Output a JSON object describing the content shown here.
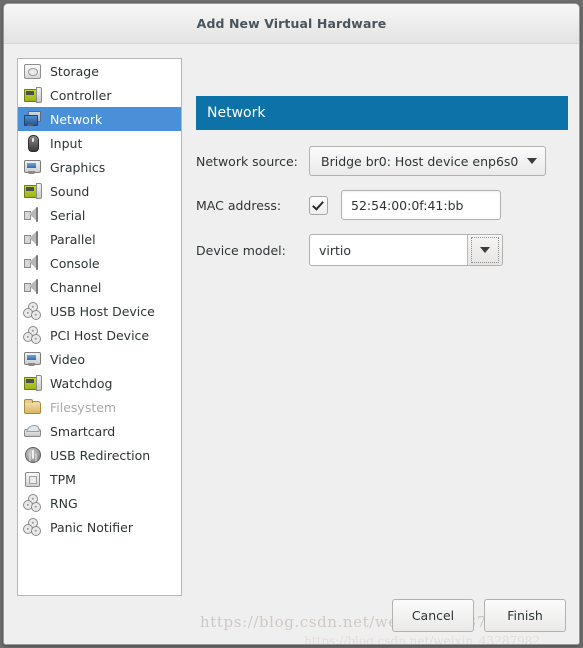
{
  "window": {
    "title": "Add New Virtual Hardware"
  },
  "sidebar": {
    "items": [
      {
        "label": "Storage",
        "icon": "drive-icon",
        "selected": false,
        "disabled": false
      },
      {
        "label": "Controller",
        "icon": "expansion-card-icon",
        "selected": false,
        "disabled": false
      },
      {
        "label": "Network",
        "icon": "network-icon",
        "selected": true,
        "disabled": false
      },
      {
        "label": "Input",
        "icon": "mouse-icon",
        "selected": false,
        "disabled": false
      },
      {
        "label": "Graphics",
        "icon": "monitor-icon",
        "selected": false,
        "disabled": false
      },
      {
        "label": "Sound",
        "icon": "expansion-card-icon",
        "selected": false,
        "disabled": false
      },
      {
        "label": "Serial",
        "icon": "speaker-icon",
        "selected": false,
        "disabled": false
      },
      {
        "label": "Parallel",
        "icon": "speaker-icon",
        "selected": false,
        "disabled": false
      },
      {
        "label": "Console",
        "icon": "speaker-icon",
        "selected": false,
        "disabled": false
      },
      {
        "label": "Channel",
        "icon": "speaker-icon",
        "selected": false,
        "disabled": false
      },
      {
        "label": "USB Host Device",
        "icon": "gears-icon",
        "selected": false,
        "disabled": false
      },
      {
        "label": "PCI Host Device",
        "icon": "gears-icon",
        "selected": false,
        "disabled": false
      },
      {
        "label": "Video",
        "icon": "monitor-icon",
        "selected": false,
        "disabled": false
      },
      {
        "label": "Watchdog",
        "icon": "expansion-card-icon",
        "selected": false,
        "disabled": false
      },
      {
        "label": "Filesystem",
        "icon": "folder-icon",
        "selected": false,
        "disabled": true
      },
      {
        "label": "Smartcard",
        "icon": "smartcard-icon",
        "selected": false,
        "disabled": false
      },
      {
        "label": "USB Redirection",
        "icon": "usb-icon",
        "selected": false,
        "disabled": false
      },
      {
        "label": "TPM",
        "icon": "chip-icon",
        "selected": false,
        "disabled": false
      },
      {
        "label": "RNG",
        "icon": "gears-icon",
        "selected": false,
        "disabled": false
      },
      {
        "label": "Panic Notifier",
        "icon": "gears-icon",
        "selected": false,
        "disabled": false
      }
    ]
  },
  "panel": {
    "header": "Network",
    "fields": {
      "network_source_label": "Network source:",
      "network_source_value": "Bridge br0: Host device enp6s0",
      "mac_address_label": "MAC address:",
      "mac_address_value": "52:54:00:0f:41:bb",
      "mac_address_checked": true,
      "device_model_label": "Device model:",
      "device_model_value": "virtio"
    }
  },
  "footer": {
    "cancel_label": "Cancel",
    "finish_label": "Finish"
  },
  "watermark": {
    "line1": "https://blog.csdn.net/weixin_43287982",
    "line2": "https://blog.csdn.net/weixin_43287982"
  },
  "colors": {
    "header_blue": "#0d72a8",
    "selection_blue": "#4a90d9",
    "title_text": "#4a545c",
    "window_bg": "#f0eff0"
  }
}
